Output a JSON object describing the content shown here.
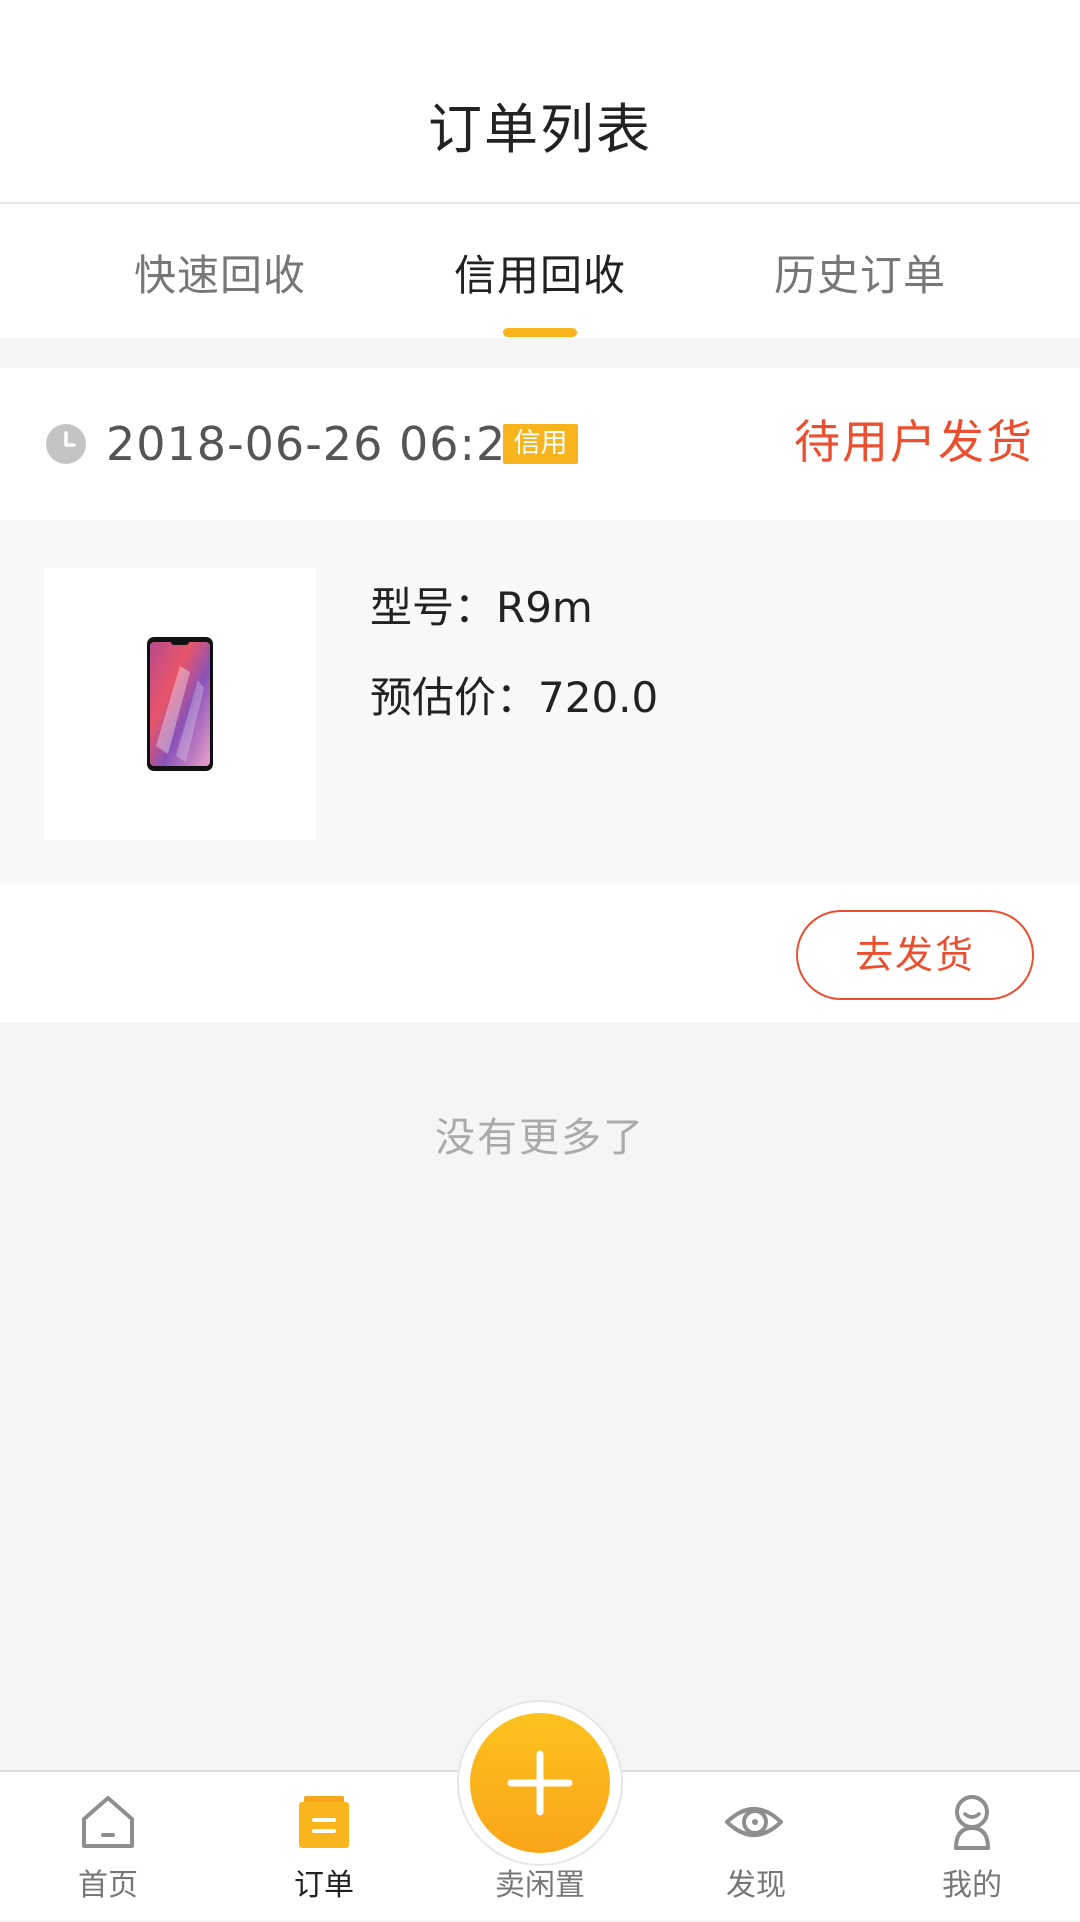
{
  "header": {
    "title": "订单列表"
  },
  "tabs": [
    {
      "label": "快速回收",
      "active": false
    },
    {
      "label": "信用回收",
      "active": true
    },
    {
      "label": "历史订单",
      "active": false
    }
  ],
  "order": {
    "time": "2018-06-26 06:21",
    "badge": "信用",
    "status": "待用户发货",
    "product_image_icon": "smartphone-icon",
    "model_label": "型号：",
    "model_value": "R9m",
    "price_label": "预估价：",
    "price_value": "720.0",
    "action_label": "去发货"
  },
  "list_end_text": "没有更多了",
  "bottom_nav": [
    {
      "label": "首页",
      "icon": "home-icon",
      "active": false
    },
    {
      "label": "订单",
      "icon": "order-icon",
      "active": true
    },
    {
      "label": "卖闲置",
      "icon": "plus-icon",
      "active": false
    },
    {
      "label": "发现",
      "icon": "eye-icon",
      "active": false
    },
    {
      "label": "我的",
      "icon": "profile-icon",
      "active": false
    }
  ],
  "colors": {
    "accent": "#f8b41c",
    "status": "#eb4f2f"
  }
}
